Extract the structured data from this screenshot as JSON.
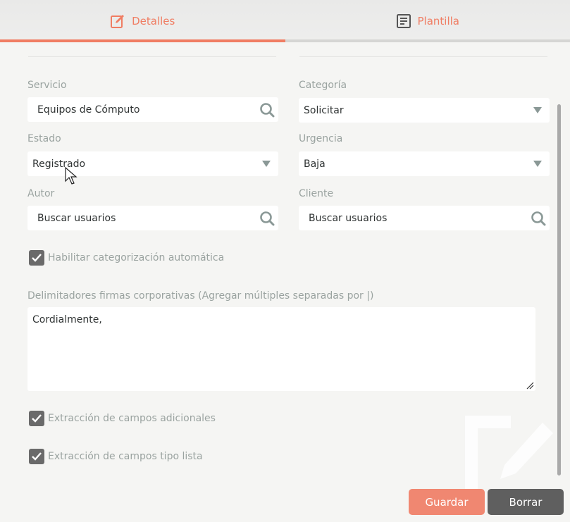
{
  "tabs": [
    {
      "label": "Detalles",
      "icon": "edit-icon",
      "active": true
    },
    {
      "label": "Plantilla",
      "icon": "document-icon",
      "active": false
    }
  ],
  "form": {
    "servicio": {
      "label": "Servicio",
      "value": "Equipos de Cómputo"
    },
    "categoria": {
      "label": "Categoría",
      "value": "Solicitar"
    },
    "estado": {
      "label": "Estado",
      "value": "Registrado"
    },
    "urgencia": {
      "label": "Urgencia",
      "value": "Baja"
    },
    "autor": {
      "label": "Autor",
      "value": "Buscar usuarios"
    },
    "cliente": {
      "label": "Cliente",
      "value": "Buscar usuarios"
    }
  },
  "auto_categorization": {
    "label": "Habilitar categorización automática",
    "checked": true
  },
  "delimiters": {
    "label": "Delimitadores firmas corporativas (Agregar múltiples separadas por |)",
    "value": "Cordialmente,"
  },
  "extra_fields": {
    "label": "Extracción de campos adicionales",
    "checked": true
  },
  "list_fields": {
    "label": "Extracción de campos tipo lista",
    "checked": true
  },
  "buttons": {
    "save": "Guardar",
    "delete": "Borrar"
  },
  "colors": {
    "accent": "#f07d63",
    "save": "#f08771",
    "delete": "#5f5f5f",
    "label": "#9aa3a0"
  }
}
